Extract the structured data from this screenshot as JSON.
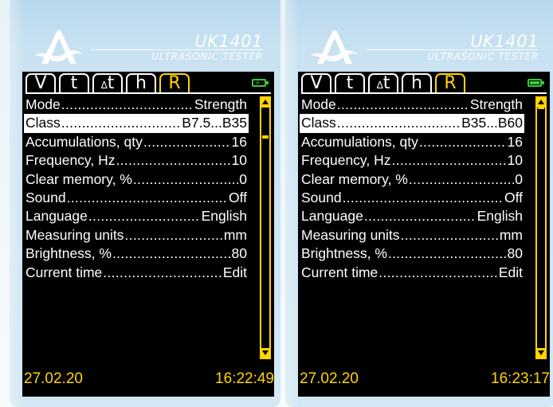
{
  "devices": [
    {
      "model": "UK1401",
      "subtitle": "ULTRASONIC TESTER",
      "tabs": [
        "V",
        "t",
        "t",
        "h",
        "R"
      ],
      "delta_symbol": "Δ",
      "battery": "charging",
      "menu": [
        {
          "label": "Mode",
          "value": "Strength"
        },
        {
          "label": "Class",
          "value": "B7.5...B35"
        },
        {
          "label": "Accumulations, qty",
          "value": "16"
        },
        {
          "label": "Frequency, Hz",
          "value": "10"
        },
        {
          "label": "Clear memory, %",
          "value": "0"
        },
        {
          "label": "Sound",
          "value": "Off"
        },
        {
          "label": "Language",
          "value": "English"
        },
        {
          "label": "Measuring units",
          "value": "mm"
        },
        {
          "label": "Brightness, %",
          "value": "80"
        },
        {
          "label": "Current time",
          "value": "Edit"
        }
      ],
      "selected_index": 1,
      "date": "27.02.20",
      "time": "16:22:49"
    },
    {
      "model": "UK1401",
      "subtitle": "ULTRASONIC TESTER",
      "tabs": [
        "V",
        "t",
        "t",
        "h",
        "R"
      ],
      "delta_symbol": "Δ",
      "battery": "full",
      "menu": [
        {
          "label": "Mode",
          "value": "Strength"
        },
        {
          "label": "Class",
          "value": "B35...B60"
        },
        {
          "label": "Accumulations, qty",
          "value": "16"
        },
        {
          "label": "Frequency, Hz",
          "value": "10"
        },
        {
          "label": "Clear memory, %",
          "value": "0"
        },
        {
          "label": "Sound",
          "value": "Off"
        },
        {
          "label": "Language",
          "value": "English"
        },
        {
          "label": "Measuring units",
          "value": "mm"
        },
        {
          "label": "Brightness, %",
          "value": "80"
        },
        {
          "label": "Current time",
          "value": "Edit"
        }
      ],
      "selected_index": 1,
      "date": "27.02.20",
      "time": "16:23:17"
    }
  ],
  "colors": {
    "accent": "#ffd400",
    "screen_bg": "#000000",
    "text": "#ffffff",
    "battery": "#38c938",
    "device_bg": "#c9e2f1"
  },
  "icons": {
    "logo": "akustik-logo-icon",
    "battery_left": "battery-charging-icon",
    "battery_right": "battery-full-icon",
    "scroll_up": "arrow-up-icon",
    "scroll_down": "arrow-down-icon"
  }
}
